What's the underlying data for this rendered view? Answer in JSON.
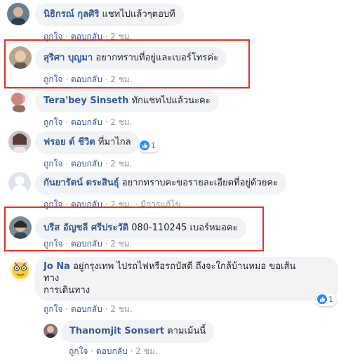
{
  "comments": [
    {
      "author": "นิธิกรณ์ กุลศิริ",
      "text": "แชทไปแล้วๆตอบที",
      "like": "ถูกใจ",
      "reply": "ตอบกลับ",
      "time": "2 ชม."
    },
    {
      "author": "สุริศา บุญมา",
      "text": "อยากทราบที่อยู่และเบอร์โทรค่ะ",
      "like": "ถูกใจ",
      "reply": "ตอบกลับ",
      "time": "2 ชม."
    },
    {
      "author": "Tera'bey Sinseth",
      "text": "ทักแชทไปแล้วนะคะ",
      "like": "ถูกใจ",
      "reply": "ตอบกลับ",
      "time": "2 ชม."
    },
    {
      "author": "ฟรอย ด์ ชีวิต",
      "text": "ที่มาไกล",
      "like": "ถูกใจ",
      "reply": "ตอบกลับ",
      "time": "2 ชม.",
      "reaction_count": "1"
    },
    {
      "author": "กันยารัตน์ ตระสินธุ์",
      "text": "อยากทราบคะขอรายละเอียดที่อยู่ด้วยคะ",
      "like": "ถูกใจ",
      "reply": "ตอบกลับ",
      "time": "2 ชม.",
      "edited": "มีการแก้ไข"
    },
    {
      "author": "บรีส อัญชลี ศรีประวัติ",
      "text": "080-110245 เบอร์หมอคะ",
      "like": "ถูกใจ",
      "reply": "ตอบกลับ",
      "time": "2 ชม."
    },
    {
      "author": "Jo Na",
      "text_line1": "อยู่กรุงเทพ ไปรถไฟหรือรถบัสดี ถึงจะใกล้บ้านหมอ ขอเส้น",
      "text_line2": "ทาง",
      "text_line3": "การเดินทาง",
      "like": "ถูกใจ",
      "reply": "ตอบกลับ",
      "time": "2 ชม.",
      "reaction_count": "1"
    },
    {
      "author": "Thanomjit Sonsert",
      "text": "ตามเม้นนี้",
      "like": "ถูกใจ",
      "reply": "ตอบกลับ",
      "time": "2 ชม."
    }
  ],
  "separator": "·",
  "colors": {
    "link": "#385898",
    "bubble": "#f2f3f5",
    "highlight": "#e0331e",
    "like": "#2d88ff"
  }
}
